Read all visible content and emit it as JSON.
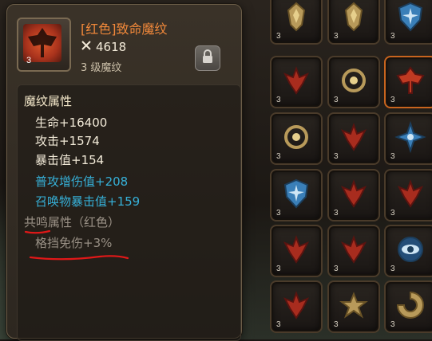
{
  "tooltip": {
    "item_level": "3",
    "title": "[红色]致命魔纹",
    "power_icon": "crossed-swords-icon",
    "power_value": "4618",
    "subtitle": "3 级魔纹",
    "lock_icon": "lock-icon",
    "section_title": "魔纹属性",
    "stats": [
      {
        "label": "生命+16400"
      },
      {
        "label": "攻击+1574"
      },
      {
        "label": "暴击值+154"
      },
      {
        "label": "普攻增伤值+208"
      },
      {
        "label": "召唤物暴击值+159"
      }
    ],
    "resonance_title": "共鸣属性（红色）",
    "resonance_value": "格挡免伤+3%"
  },
  "colors": {
    "title": "#f0883a",
    "stat_blue": "#36b0d8",
    "resonance_gray": "#9a9186",
    "annotation_red": "#e01818",
    "slot_border_orange": "#c8641e"
  },
  "rune_grid": {
    "slots": [
      {
        "level": "3",
        "icon": "golden-mask-rune-icon"
      },
      {
        "level": "3",
        "icon": "golden-mask-rune-icon"
      },
      {
        "level": "3",
        "icon": "blue-shield-rune-icon"
      },
      {
        "level": "3",
        "icon": "red-wing-rune-icon"
      },
      {
        "level": "3",
        "icon": "golden-swirl-rune-icon"
      },
      {
        "level": "3",
        "icon": "red-axe-rune-icon"
      },
      {
        "level": "3",
        "icon": "golden-swirl-rune-icon"
      },
      {
        "level": "3",
        "icon": "red-wing-rune-icon"
      },
      {
        "level": "3",
        "icon": "blue-star-rune-icon"
      },
      {
        "level": "3",
        "icon": "blue-shield-rune-icon"
      },
      {
        "level": "3",
        "icon": "red-wing-rune-icon"
      },
      {
        "level": "3",
        "icon": "red-wing-rune-icon"
      },
      {
        "level": "3",
        "icon": "red-wing-rune-icon"
      },
      {
        "level": "3",
        "icon": "red-wing-rune-icon"
      },
      {
        "level": "3",
        "icon": "blue-eye-rune-icon"
      },
      {
        "level": "3",
        "icon": "red-wing-rune-icon"
      },
      {
        "level": "3",
        "icon": "golden-flower-rune-icon"
      },
      {
        "level": "3",
        "icon": "golden-spiral-rune-icon"
      }
    ]
  }
}
